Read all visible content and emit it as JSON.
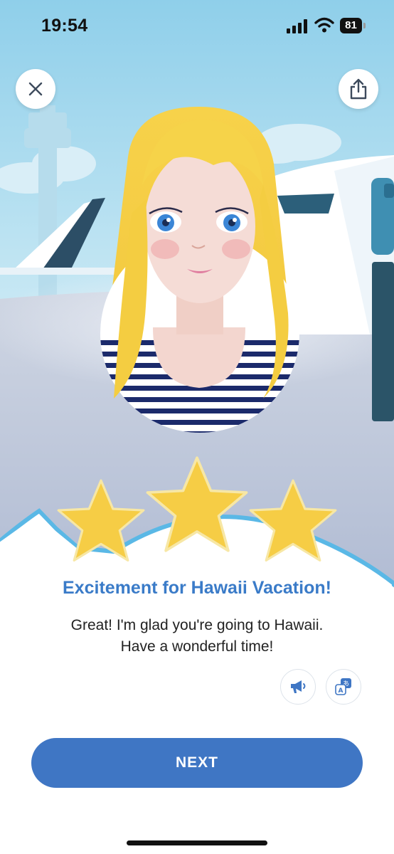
{
  "status_bar": {
    "time": "19:54",
    "battery": "81"
  },
  "header": {
    "close_icon": "close-icon",
    "share_icon": "share-icon"
  },
  "scene": {
    "description_icons": [
      "airport-tower",
      "airplane",
      "avatar-character"
    ],
    "stars_earned": 3,
    "stars_total": 3,
    "star_color": "#f6cd45"
  },
  "result": {
    "title": "Excitement for Hawaii Vacation!",
    "message_line1": "Great! I'm glad you're going to Hawaii.",
    "message_line2": "Have a wonderful time!"
  },
  "actions": {
    "audio_icon": "megaphone-icon",
    "translate_icon": "translate-icon",
    "next_label": "NEXT"
  },
  "colors": {
    "accent": "#3f76c4",
    "title": "#3a7bc8",
    "sky": "#a9d8ec"
  }
}
